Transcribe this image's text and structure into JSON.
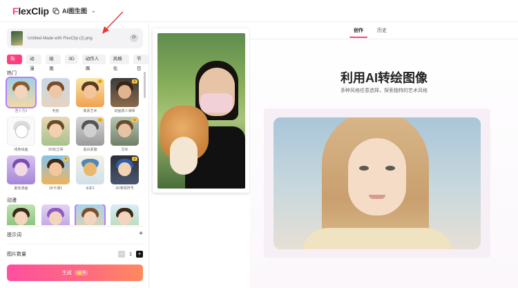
{
  "header": {
    "logo_text": "FlexClip",
    "mode_label": "AI图生图"
  },
  "upload": {
    "file_name": "Untitled-Made with FlexClip (2).png"
  },
  "categories": [
    "热门",
    "动漫",
    "绘画",
    "3D",
    "动作人偶",
    "风格化",
    "节日"
  ],
  "active_category": "热门",
  "sections": {
    "hot": {
      "title": "热门",
      "styles": [
        {
          "label": "吉卜力1",
          "premium": false,
          "selected": true
        },
        {
          "label": "毛毡",
          "premium": false,
          "selected": false
        },
        {
          "label": "像素艺术",
          "premium": true,
          "selected": false
        },
        {
          "label": "动画真人演绎",
          "premium": true,
          "selected": false
        },
        {
          "label": "线条绘画",
          "premium": false,
          "selected": false
        },
        {
          "label": "3D玩立得",
          "premium": false,
          "selected": false
        },
        {
          "label": "黑白素描",
          "premium": true,
          "selected": false
        },
        {
          "label": "写实",
          "premium": true,
          "selected": false
        },
        {
          "label": "紫色漫画",
          "premium": false,
          "selected": false
        },
        {
          "label": "3D卡通1",
          "premium": true,
          "selected": false
        },
        {
          "label": "水彩1",
          "premium": false,
          "selected": false
        },
        {
          "label": "3D表情符号",
          "premium": true,
          "selected": false
        }
      ]
    },
    "anime": {
      "title": "动漫",
      "styles": [
        {
          "label": "",
          "premium": false,
          "selected": false
        },
        {
          "label": "",
          "premium": false,
          "selected": false
        },
        {
          "label": "",
          "premium": false,
          "selected": true
        },
        {
          "label": "",
          "premium": false,
          "selected": false
        }
      ]
    }
  },
  "prompt": {
    "label": "提示词",
    "add_symbol": "+"
  },
  "image_count": {
    "label": "图片数量",
    "value": "1",
    "minus_symbol": "−",
    "plus_symbol": "+"
  },
  "generate": {
    "label": "生成",
    "cost": "4"
  },
  "right": {
    "tabs": [
      "创作",
      "历史"
    ],
    "active_tab": "创作",
    "title": "利用AI转绘图像",
    "subtitle": "多种风格任意选择，探索独特的艺术风格"
  },
  "colors": {
    "accent": "#ff3e7f",
    "premium_badge": "#f7c245",
    "selected_outline": "#b77bff",
    "annotation_arrow": "#e53935"
  },
  "icons": {
    "mode": "image-to-image-icon",
    "swap": "swap-image-icon",
    "premium": "crown-icon",
    "coin": "coin-icon"
  }
}
